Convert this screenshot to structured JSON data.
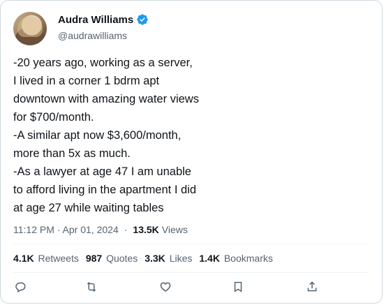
{
  "author": {
    "name": "Audra Williams",
    "handle": "@audrawilliams",
    "verified": true
  },
  "tweet": {
    "text": "-20 years ago, working as a server,\nI lived in a corner 1 bdrm apt\ndowntown with amazing water views\nfor $700/month.\n-A similar apt now $3,600/month,\nmore than 5x as much.\n-As a lawyer at age 47 I am unable\nto afford living in the apartment I did\nat age 27 while waiting tables",
    "time": "11:12 PM · Apr 01, 2024",
    "separator": "·",
    "views_count": "13.5K",
    "views_label": "Views"
  },
  "stats": [
    {
      "count": "4.1K",
      "label": "Retweets"
    },
    {
      "count": "987",
      "label": "Quotes"
    },
    {
      "count": "3.3K",
      "label": "Likes"
    },
    {
      "count": "1.4K",
      "label": "Bookmarks"
    }
  ],
  "actions": [
    "reply-icon",
    "retweet-icon",
    "like-icon",
    "bookmark-icon",
    "share-icon"
  ],
  "colors": {
    "verified": "#1d9bf0",
    "text": "#0f1419",
    "muted": "#536471",
    "border": "#cfd9de"
  }
}
